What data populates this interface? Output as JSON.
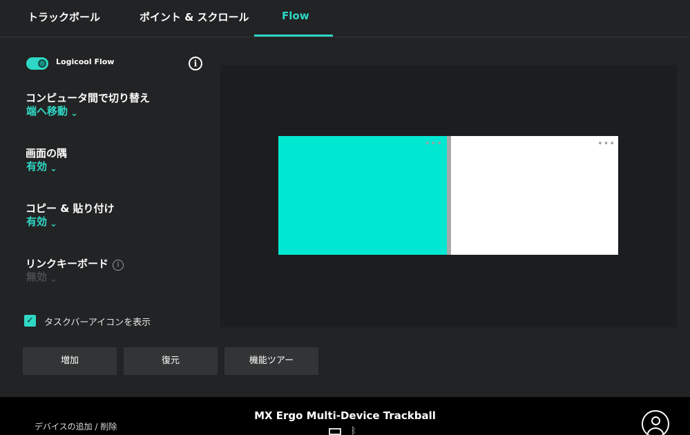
{
  "tabs": [
    {
      "label": "トラックボール"
    },
    {
      "label": "ポイント & スクロール"
    },
    {
      "label": "Flow"
    }
  ],
  "flow_toggle": {
    "label": "Logicool Flow",
    "enabled": true
  },
  "settings": {
    "switch_between": {
      "title": "コンピュータ間で切り替え",
      "value": "端へ移動"
    },
    "screen_corner": {
      "title": "画面の隅",
      "value": "有効"
    },
    "copy_paste": {
      "title": "コピー & 貼り付け",
      "value": "有効"
    },
    "link_keyboard": {
      "title": "リンクキーボード",
      "value": "無効"
    }
  },
  "taskbar_checkbox": {
    "label": "タスクバーアイコンを表示",
    "checked": true
  },
  "preview": {
    "left_screen_color": "#00e8d1",
    "right_screen_color": "#ffffff",
    "menu_glyph": "•••"
  },
  "buttons": {
    "add": "増加",
    "restore": "復元",
    "tour": "機能ツアー"
  },
  "footer": {
    "add_remove": "デバイスの追加 / 削除",
    "device_name": "MX Ergo Multi-Device Trackball",
    "bluetooth_glyph": "ᛒ"
  },
  "colors": {
    "accent": "#2fd8c6",
    "background": "#222324",
    "footer": "#000000"
  }
}
